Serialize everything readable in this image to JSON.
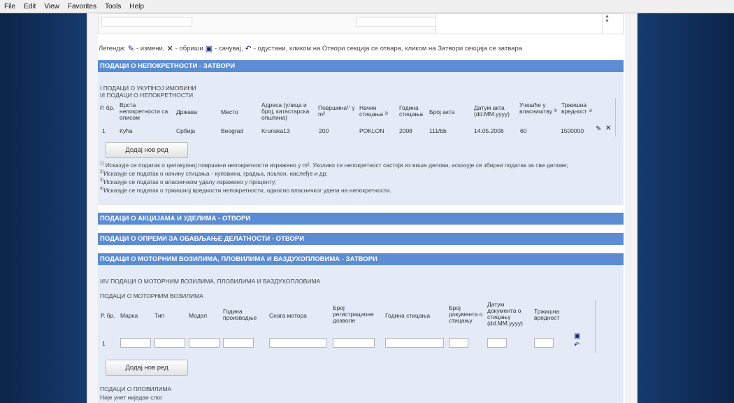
{
  "menu": [
    "File",
    "Edit",
    "View",
    "Favorites",
    "Tools",
    "Help"
  ],
  "legend": {
    "prefix": "Легенда:",
    "edit": "- измени,",
    "delete": "- обриши",
    "save": "- сачувај,",
    "cancel": "- одустани, кликом на Отвори секција се отвара, кликом на Затвори секција се затвара"
  },
  "property": {
    "header": "ПОДАЦИ О НЕПОКРЕТНОСТИ - ЗАТВОРИ",
    "sub1": "I ПОДАЦИ О УКУПНОЈ ИМОВИНИ",
    "sub2": "I/I ПОДАЦИ О НЕПОКРЕТНОСТИ",
    "columns": [
      "Р. бр.",
      "Врста непокретности са описом",
      "Држава",
      "Место",
      "Адреса (улица и број, катастарска општина)",
      "Површина¹⁾ у m²",
      "Начин стицања ²⁾",
      "Година стицања",
      "Број акта",
      "Датум акта (dd.MM.yyyy)",
      "Учешће у власништву ³⁾",
      "Тржишна вредност ⁴⁾"
    ],
    "row": [
      "1",
      "Кућа",
      "Србија",
      "Beograd",
      "Krunska13",
      "200",
      "POKLON",
      "2008",
      "111/bb",
      "14.05.2008",
      "60",
      "1500000"
    ],
    "add_row": "Додај нов ред",
    "notes": [
      "Исказује се податак о целокупној површини непокретности изражено у m². Уколико се непокретност састоји из више делова, исказује се збирни податак за све делове;",
      "Исказује се податак о начину стицања - куповина, градња, поклон, наслеђе и др;",
      "Исказује се податак о власничком уделу изражено у проценту;",
      "Исказује се податак о тржишној вредности непокретности, односно власничког удела на непокретности."
    ]
  },
  "shares_header": "ПОДАЦИ О АКЦИЈАМА И УДЕЛИМА - ОТВОРИ",
  "equipment_header": "ПОДАЦИ О ОПРЕМИ ЗА ОБАВЉАЊЕ ДЕЛАТНОСТИ - ОТВОРИ",
  "vehicles": {
    "header": "ПОДАЦИ О МОТОРНИМ ВОЗИЛИМА, ПЛОВИЛИМА И ВАЗДУХОПЛОВИМА - ЗАТВОРИ",
    "sub1": "I/IV ПОДАЦИ О МОТОРНИМ ВОЗИЛИМА, ПЛОВИЛИМА И ВАЗДУХОПЛОВИМА",
    "sub2": "ПОДАЦИ О МОТОРНИМ ВОЗИЛИМА",
    "columns": [
      "Р. бр.",
      "Марка",
      "Тип",
      "Модел",
      "Година производње",
      "Снага мотора",
      "Број регистрационе дозволе",
      "Година стицања",
      "Број документа о стицању",
      "Датум документа о стицању (dd.MM.yyyy)",
      "Тржишна вредност"
    ],
    "row_num": "1",
    "add_row": "Додај нов ред",
    "boats_title": "ПОДАЦИ О ПЛОВИЛИМА",
    "boats_empty": "Није унет ниједан слог"
  }
}
